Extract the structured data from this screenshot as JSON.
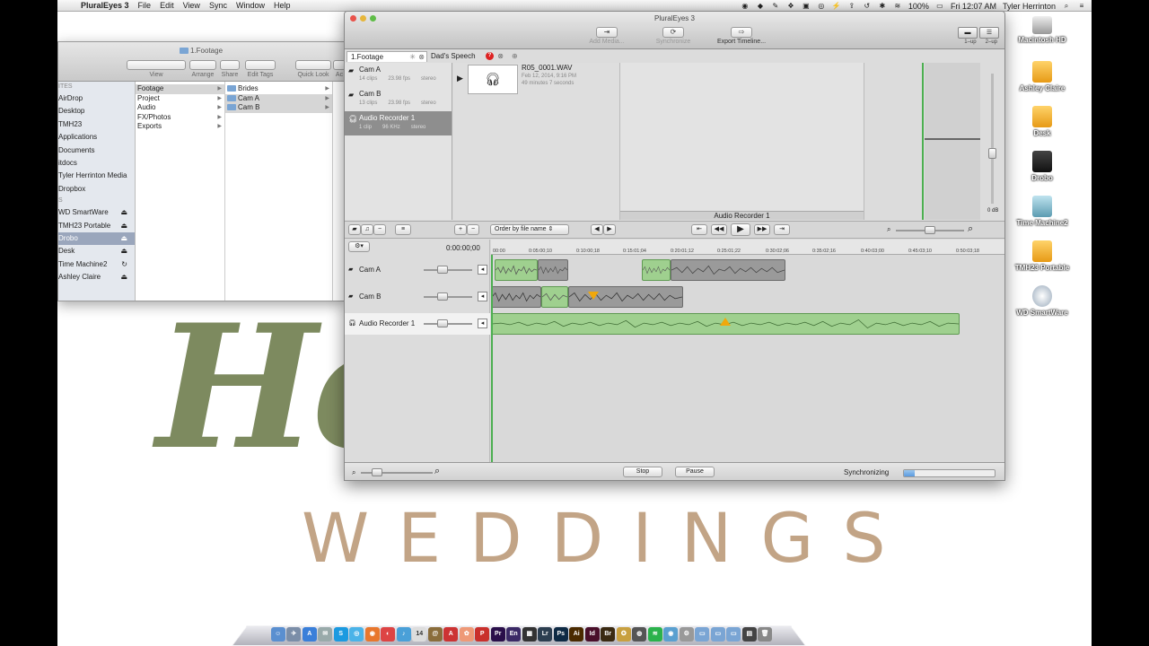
{
  "menubar": {
    "app": "PluralEyes 3",
    "menus": [
      "File",
      "Edit",
      "View",
      "Sync",
      "Window",
      "Help"
    ],
    "battery": "100%",
    "clock": "Fri 12:07 AM",
    "user": "Tyler Herrinton"
  },
  "background": {
    "logo_big": "He",
    "logo_sub": "WEDDINGS"
  },
  "desktop_icons": [
    "Macintosh HD",
    "Ashley Claire",
    "Desk",
    "Drobo",
    "Time Machine2",
    "TMH23 Portable",
    "WD SmartWare"
  ],
  "finder": {
    "title": "1.Footage",
    "toolbar": [
      "View",
      "Arrange",
      "Share",
      "Edit Tags",
      "Quick Look",
      "Ac"
    ],
    "sidebar_header_favorites": "ITES",
    "sidebar_header_devices": "S",
    "sidebar": [
      "AirDrop",
      "Desktop",
      "TMH23",
      "Applications",
      "Documents",
      "itdocs",
      "Tyler Herrinton Media",
      "Dropbox"
    ],
    "devices": [
      {
        "label": "WD SmartWare",
        "icon": "eject"
      },
      {
        "label": "TMH23 Portable",
        "icon": "eject"
      },
      {
        "label": "Drobo",
        "icon": "eject",
        "selected": true
      },
      {
        "label": "Desk",
        "icon": "eject"
      },
      {
        "label": "Time Machine2",
        "icon": "sync"
      },
      {
        "label": "Ashley Claire",
        "icon": "eject"
      }
    ],
    "col1": [
      "Footage",
      "Project",
      "Audio",
      "FX/Photos",
      "Exports"
    ],
    "col2": [
      "Brides",
      "Cam A",
      "Cam B"
    ]
  },
  "pe": {
    "title": "PluralEyes 3",
    "tools": {
      "add_media": "Add Media...",
      "synchronize": "Synchronize",
      "export": "Export Timeline..."
    },
    "layout": {
      "one": "1–up",
      "two": "2–up"
    },
    "tabs": {
      "footage": "1.Footage",
      "speech": "Dad's Speech",
      "badge": "?"
    },
    "sources": [
      {
        "name": "Cam A",
        "clips": "14 clips",
        "fps": "23.98 fps",
        "ch": "stereo"
      },
      {
        "name": "Cam B",
        "clips": "13 clips",
        "fps": "23.98 fps",
        "ch": "stereo"
      },
      {
        "name": "Audio Recorder 1",
        "clips": "1 clip",
        "fps": "96 KHz",
        "ch": "stereo"
      }
    ],
    "clip": {
      "name": "R05_0001.WAV",
      "date": "Feb 12, 2014, 9:16 PM",
      "duration": "49 minutes 7 seconds"
    },
    "preview_label": "Audio Recorder 1",
    "meter_label": "0 dB",
    "order_by": "Order by file name",
    "timecode": "0:00:00;00",
    "ruler": [
      "00:00",
      "0:05:00;10",
      "0:10:00;18",
      "0:15:01;04",
      "0:20:01;12",
      "0:25:01;22",
      "0:30:02;06",
      "0:35:02;16",
      "0:40:03;00",
      "0:45:03;10",
      "0:50:03;18"
    ],
    "tracks": [
      "Cam A",
      "Cam B",
      "Audio Recorder 1"
    ],
    "stop": "Stop",
    "pause": "Pause",
    "status": "Synchronizing",
    "progress": 0.12
  }
}
